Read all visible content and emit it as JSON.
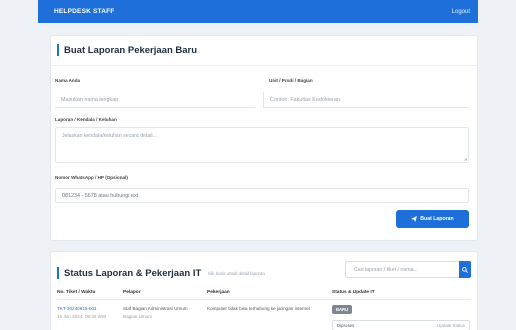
{
  "header": {
    "brand": "HELPDESK STAFF",
    "logout": "Logout"
  },
  "form": {
    "title": "Buat Laporan Pekerjaan Baru",
    "name_label": "Nama Anda",
    "name_placeholder": "Masukan nama lengkap",
    "unit_label": "Unit / Prodi / Bagian",
    "unit_placeholder": "Contoh: Fakultas Kedokteran",
    "issue_label": "Laporan / Kendala / Keluhan",
    "issue_placeholder": "Jelaskan kendala/keluhan secara detail...",
    "phone_label": "Nomor WhatsApp / HP (Opsional)",
    "phone_value": "081234 - 5678 atau hubungi ext",
    "submit_label": "Buat Laporan",
    "submit_icon": "paper-plane-icon"
  },
  "status": {
    "title": "Status Laporan & Pekerjaan IT",
    "hint": "klik baris untuk detail laporan",
    "search_placeholder": "Cari laporan / tiket / nama...",
    "search_icon": "search-icon",
    "columns": [
      "No. Tiket / Waktu",
      "Pelapor",
      "Pekerjaan",
      "Status & Update IT"
    ],
    "rows": [
      {
        "ticket": "TKT-20240615-001",
        "time": "15 Jun 2024, 08:30 WIB",
        "reporter": "Staf Bagian Administrasi Umum",
        "reporter_unit": "Bagian Umum",
        "job": "Komputer tidak bisa terhubung ke jaringan internet",
        "badge": "BARU",
        "status_select": "Diproses",
        "status_select_right": "Update Status"
      }
    ]
  },
  "colors": {
    "accent": "#1e6fd9",
    "background": "#eef1f5",
    "badge": "#7d8793"
  }
}
